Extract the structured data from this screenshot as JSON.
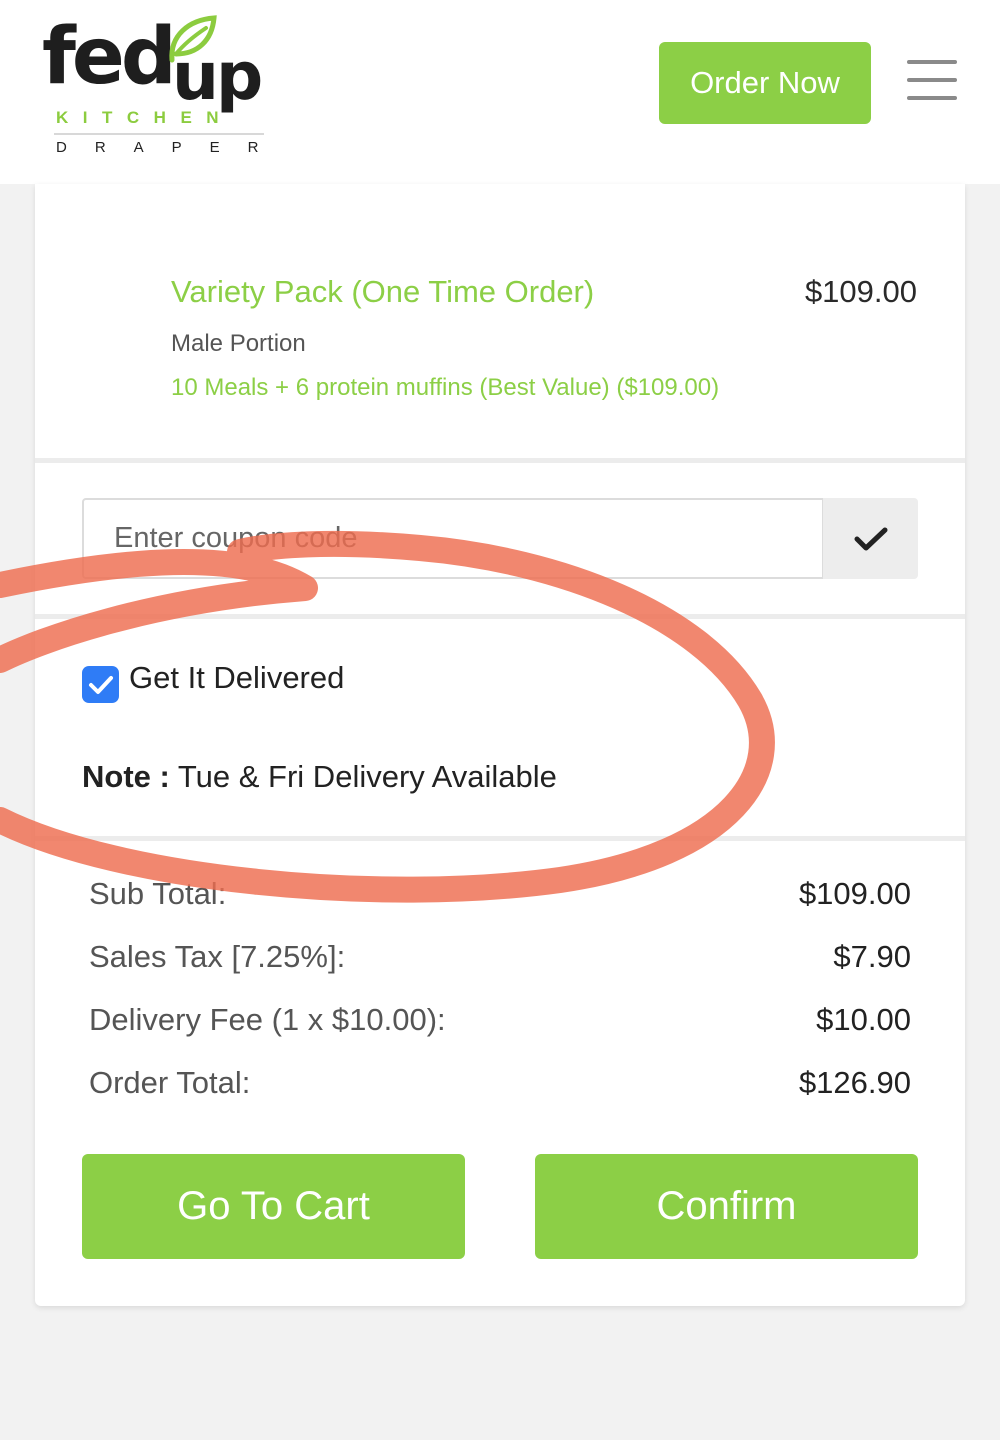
{
  "header": {
    "logo": {
      "line1_a": "fed",
      "line1_b": "up",
      "line2": "KITCHEN",
      "line3": "DRAPER"
    },
    "order_now_label": "Order Now",
    "menu_icon": "hamburger-menu-icon"
  },
  "item": {
    "name": "Variety Pack (One Time Order)",
    "price": "$109.00",
    "portion": "Male Portion",
    "option": "10 Meals + 6 protein muffins (Best Value)  ($109.00)"
  },
  "coupon": {
    "placeholder": "Enter coupon code",
    "value": "",
    "apply_icon": "checkmark-icon"
  },
  "delivery": {
    "checked": true,
    "label": "Get It Delivered",
    "note_label": "Note :",
    "note_text": " Tue & Fri Delivery Available"
  },
  "summary": [
    {
      "label": "Sub Total:",
      "value": "$109.00"
    },
    {
      "label": "Sales Tax [7.25%]:",
      "value": "$7.90"
    },
    {
      "label": "Delivery Fee (1 x $10.00):",
      "value": "$10.00"
    },
    {
      "label": "Order Total:",
      "value": "$126.90"
    }
  ],
  "actions": {
    "go_to_cart_label": "Go To Cart",
    "confirm_label": "Confirm"
  },
  "colors": {
    "brand_green": "#8ccf46",
    "checkbox_blue": "#2f7cf6",
    "annotation_orange": "#ee6d4f"
  }
}
